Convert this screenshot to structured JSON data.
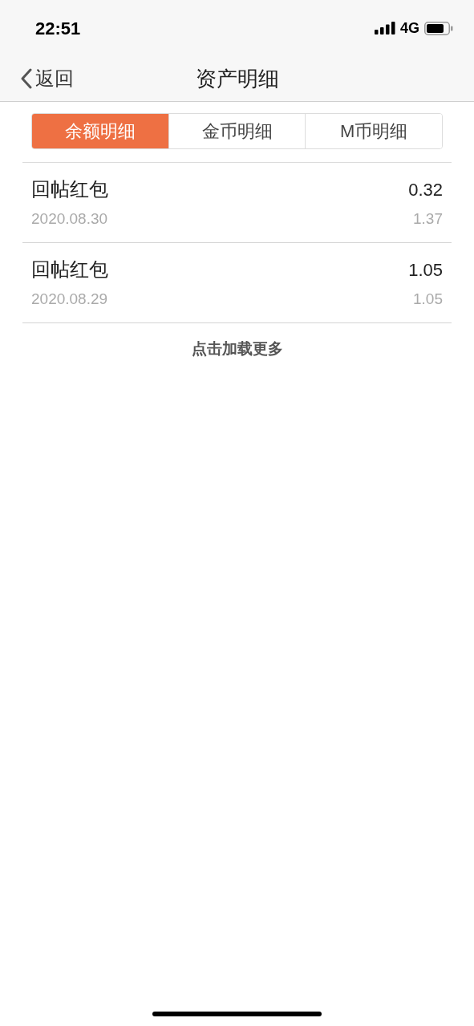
{
  "status_bar": {
    "time": "22:51",
    "network": "4G"
  },
  "nav": {
    "back_label": "返回",
    "title": "资产明细"
  },
  "tabs": [
    {
      "label": "余额明细",
      "selected": true
    },
    {
      "label": "金币明细",
      "selected": false
    },
    {
      "label": "M币明细",
      "selected": false
    }
  ],
  "records": [
    {
      "title": "回帖红包",
      "amount": "0.32",
      "date": "2020.08.30",
      "balance": "1.37"
    },
    {
      "title": "回帖红包",
      "amount": "1.05",
      "date": "2020.08.29",
      "balance": "1.05"
    }
  ],
  "load_more": "点击加载更多"
}
